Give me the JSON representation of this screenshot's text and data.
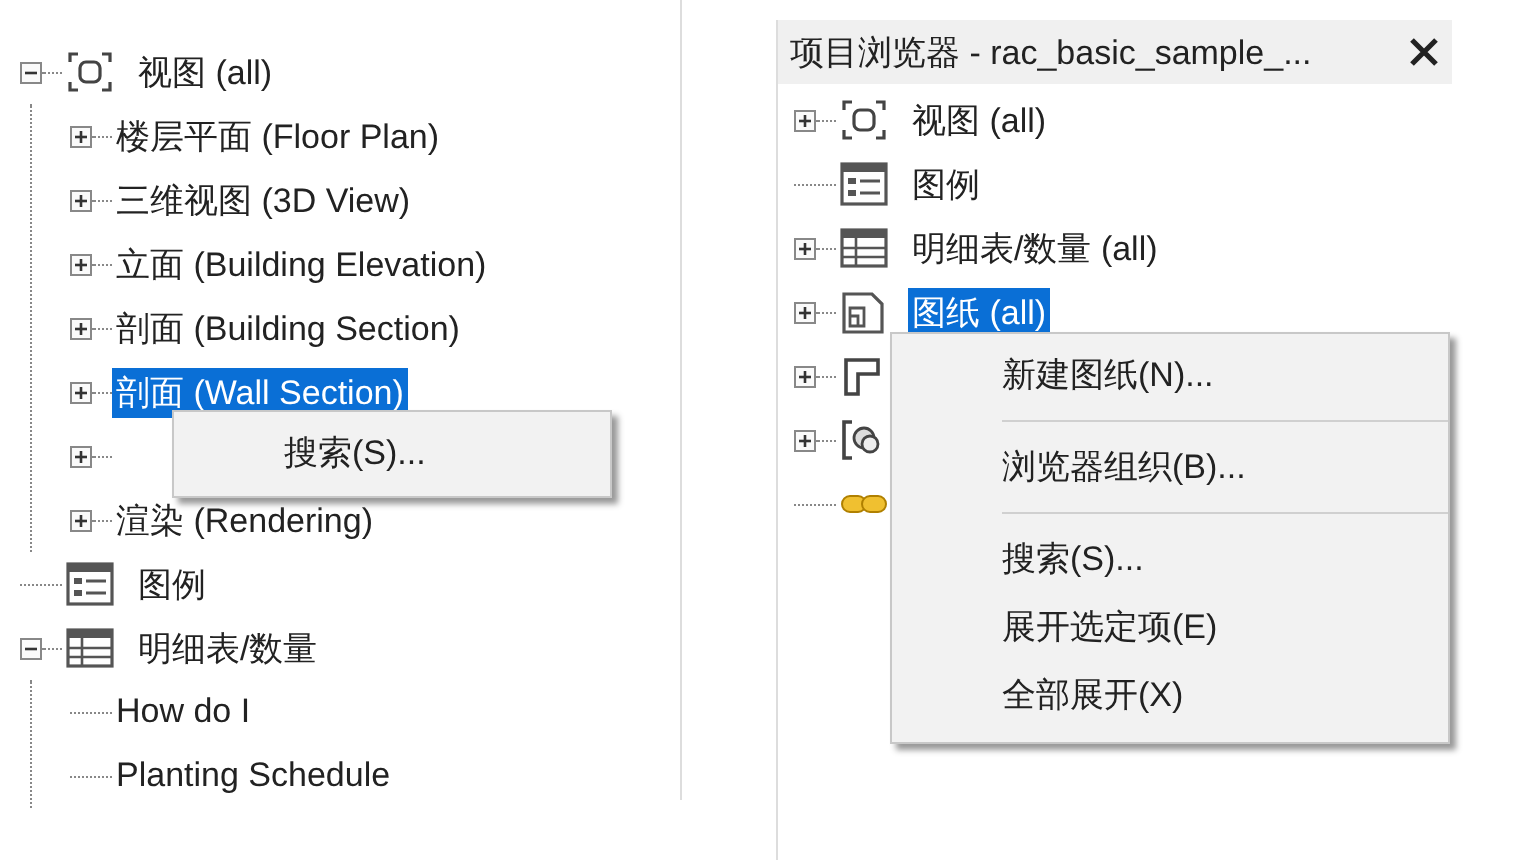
{
  "left_panel": {
    "nodes": [
      {
        "kind": "views",
        "label": "视图 (all)",
        "expanded": true,
        "selected": false,
        "children": [
          {
            "label": "楼层平面 (Floor Plan)",
            "expanded": false,
            "selected": false
          },
          {
            "label": "三维视图 (3D View)",
            "expanded": false,
            "selected": false
          },
          {
            "label": "立面 (Building Elevation)",
            "expanded": false,
            "selected": false
          },
          {
            "label": "剖面 (Building Section)",
            "expanded": false,
            "selected": false
          },
          {
            "label": "剖面 (Wall Section)",
            "expanded": false,
            "selected": true
          },
          {
            "expanded": false
          },
          {
            "label": "渲染 (Rendering)",
            "expanded": false,
            "selected": false
          }
        ]
      },
      {
        "kind": "legend",
        "label": "图例",
        "selected": false
      },
      {
        "kind": "schedule",
        "label": "明细表/数量",
        "expanded": true,
        "selected": false,
        "children": [
          {
            "label": "How do I",
            "selected": false
          },
          {
            "label": "Planting Schedule",
            "selected": false
          }
        ]
      }
    ],
    "context_menu": {
      "items": [
        {
          "kind": "item",
          "label": "搜索(S)..."
        }
      ]
    }
  },
  "right_panel": {
    "title": "项目浏览器 - rac_basic_sample_...",
    "nodes": [
      {
        "kind": "views",
        "label": "视图 (all)",
        "expanded": false,
        "selected": false
      },
      {
        "kind": "legend",
        "label": "图例",
        "selected": false
      },
      {
        "kind": "schedule",
        "label": "明细表/数量 (all)",
        "expanded": false,
        "selected": false
      },
      {
        "kind": "sheet",
        "label": "图纸 (all)",
        "expanded": false,
        "selected": true
      },
      {
        "kind": "family",
        "expanded": false
      },
      {
        "kind": "group",
        "expanded": false
      },
      {
        "kind": "link"
      }
    ],
    "context_menu": {
      "items": [
        {
          "kind": "item",
          "label": "新建图纸(N)..."
        },
        {
          "kind": "separator"
        },
        {
          "kind": "item",
          "label": "浏览器组织(B)..."
        },
        {
          "kind": "separator"
        },
        {
          "kind": "item",
          "label": "搜索(S)..."
        },
        {
          "kind": "item",
          "label": "展开选定项(E)"
        },
        {
          "kind": "item",
          "label": "全部展开(X)"
        }
      ]
    }
  }
}
